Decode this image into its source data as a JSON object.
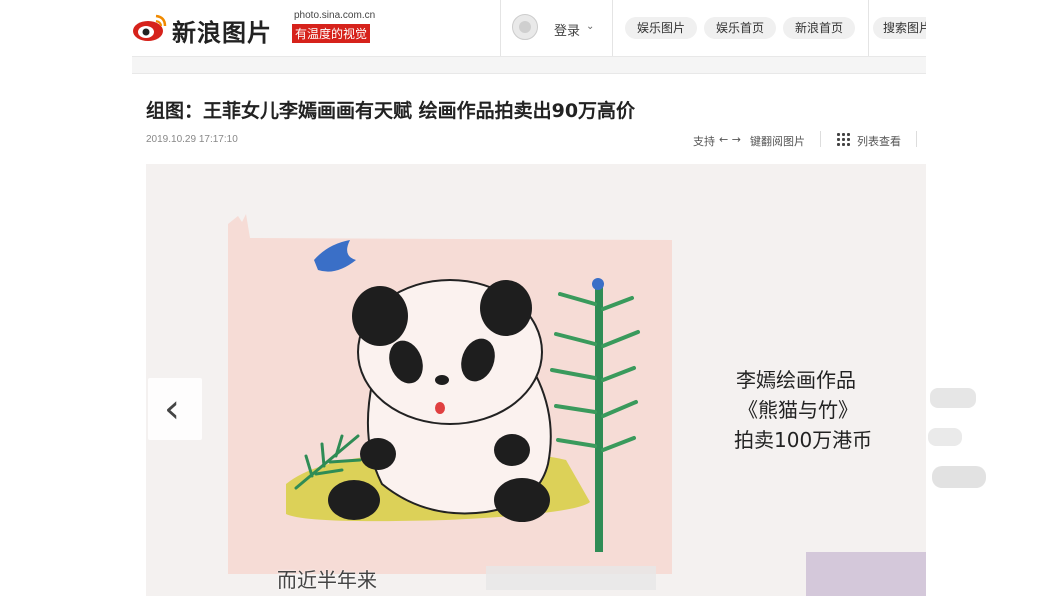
{
  "header": {
    "logo_text": "新浪图片",
    "logo_url": "photo.sina.com.cn",
    "logo_tag": "有温度的视觉",
    "login_label": "登录",
    "nav": [
      "娱乐图片",
      "娱乐首页",
      "新浪首页",
      "搜索图片"
    ]
  },
  "article": {
    "title": "组图：王菲女儿李嫣画画有天赋 绘画作品拍卖出90万高价",
    "date": "2019.10.29 17:17:10",
    "tools": {
      "support": "支持",
      "keyboard": "键翻阅图片",
      "list_view": "列表查看"
    }
  },
  "image": {
    "caption": [
      "李嫣绘画作品",
      "《熊猫与竹》",
      "拍卖100万港币"
    ],
    "subtitle": "而近半年来"
  },
  "colors": {
    "brand_red": "#d6221b"
  },
  "icons": {
    "prev": "chevron-left-icon",
    "grid": "grid-icon",
    "arrows": "arrow-left-right-icon"
  }
}
